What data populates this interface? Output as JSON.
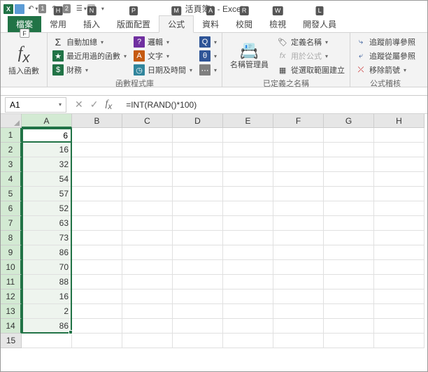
{
  "app": {
    "title": "活頁簿1 - Excel",
    "qat_badges": [
      "1",
      "2",
      "3"
    ]
  },
  "ribbon": {
    "tabs": [
      {
        "label": "檔案",
        "key": "F",
        "type": "file"
      },
      {
        "label": "常用",
        "key": "H"
      },
      {
        "label": "插入",
        "key": "N"
      },
      {
        "label": "版面配置",
        "key": "P"
      },
      {
        "label": "公式",
        "key": "M",
        "type": "active"
      },
      {
        "label": "資料",
        "key": "A"
      },
      {
        "label": "校閱",
        "key": "R"
      },
      {
        "label": "檢視",
        "key": "W"
      },
      {
        "label": "開發人員",
        "key": "L"
      }
    ],
    "groups": {
      "insert_fn": {
        "label": "插入函數"
      },
      "library": {
        "label": "函數程式庫",
        "items": {
          "autosum": "自動加總",
          "recent": "最近用過的函數",
          "financial": "財務",
          "logical": "邏輯",
          "text": "文字",
          "date": "日期及時間"
        }
      },
      "names": {
        "label": "已定義之名稱",
        "manager": "名稱管理員",
        "define": "定義名稱",
        "use": "用於公式",
        "create": "從選取範圍建立"
      },
      "audit": {
        "label": "公式稽核",
        "precedents": "追蹤前導參照",
        "dependents": "追蹤從屬參照",
        "remove": "移除箭號"
      }
    }
  },
  "formula_bar": {
    "name_box": "A1",
    "formula": "=INT(RAND()*100)"
  },
  "sheet": {
    "columns": [
      "A",
      "B",
      "C",
      "D",
      "E",
      "F",
      "G",
      "H"
    ],
    "row_nums": [
      1,
      2,
      3,
      4,
      5,
      6,
      7,
      8,
      9,
      10,
      11,
      12,
      13,
      14,
      15
    ],
    "col_a_values": [
      "6",
      "16",
      "32",
      "54",
      "57",
      "52",
      "63",
      "73",
      "86",
      "70",
      "88",
      "16",
      "2",
      "86",
      ""
    ],
    "selected_col": "A",
    "selected_rows": [
      1,
      14
    ],
    "active_cell": "A1"
  }
}
